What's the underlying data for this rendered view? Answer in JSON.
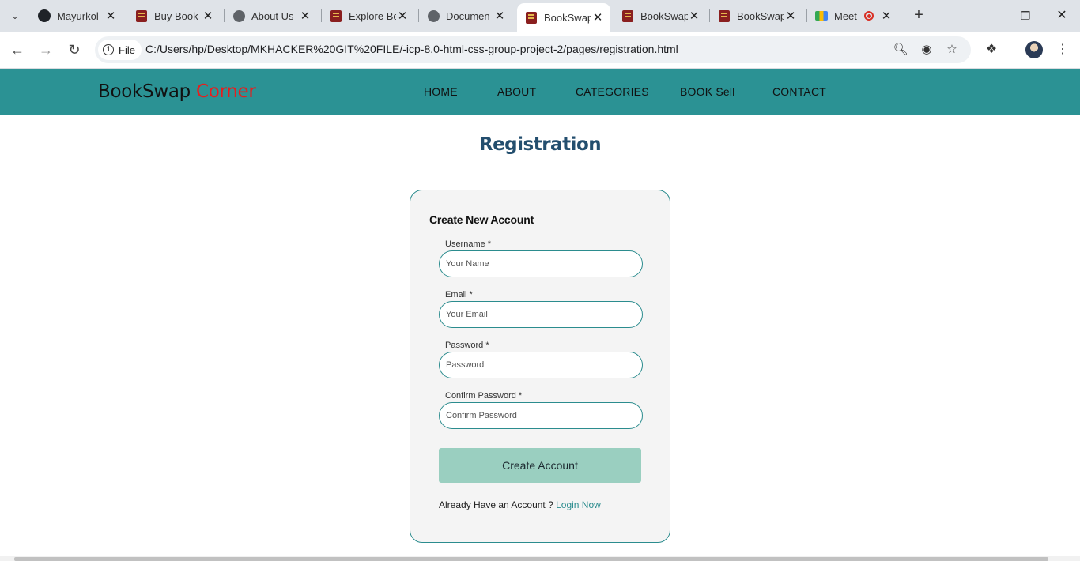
{
  "browser": {
    "tabs": [
      {
        "title": "Mayurkol",
        "favicon": "github-icon"
      },
      {
        "title": "Buy Book",
        "favicon": "book-icon"
      },
      {
        "title": "About Us",
        "favicon": "globe-icon"
      },
      {
        "title": "Explore Bo",
        "favicon": "book-icon"
      },
      {
        "title": "Documen",
        "favicon": "globe-icon"
      },
      {
        "title": "BookSwap",
        "favicon": "book-icon",
        "active": true
      },
      {
        "title": "BookSwap",
        "favicon": "book-icon"
      },
      {
        "title": "BookSwap",
        "favicon": "book-icon"
      },
      {
        "title": "Meet",
        "favicon": "meet-icon",
        "recording": true
      }
    ],
    "site_chip": "File",
    "url": "C:/Users/hp/Desktop/MKHACKER%20GIT%20FILE/-icp-8.0-html-css-group-project-2/pages/registration.html"
  },
  "header": {
    "logo_main": "BookSwap",
    "logo_accent": "Corner",
    "logo_accent_color": "#e81d1d",
    "bg_color": "#2b9294",
    "nav": [
      "HOME",
      "ABOUT",
      "CATEGORIES",
      "BOOK Sell",
      "CONTACT"
    ]
  },
  "page": {
    "title": "Registration",
    "form": {
      "heading": "Create New Account",
      "fields": [
        {
          "label": "Username *",
          "placeholder": "Your Name"
        },
        {
          "label": "Email *",
          "placeholder": "Your Email"
        },
        {
          "label": "Password *",
          "placeholder": "Password"
        },
        {
          "label": "Confirm Password *",
          "placeholder": "Confirm Password"
        }
      ],
      "submit_label": "Create Account",
      "login_prompt": "Already Have an Account ?",
      "login_link": "Login Now"
    }
  }
}
